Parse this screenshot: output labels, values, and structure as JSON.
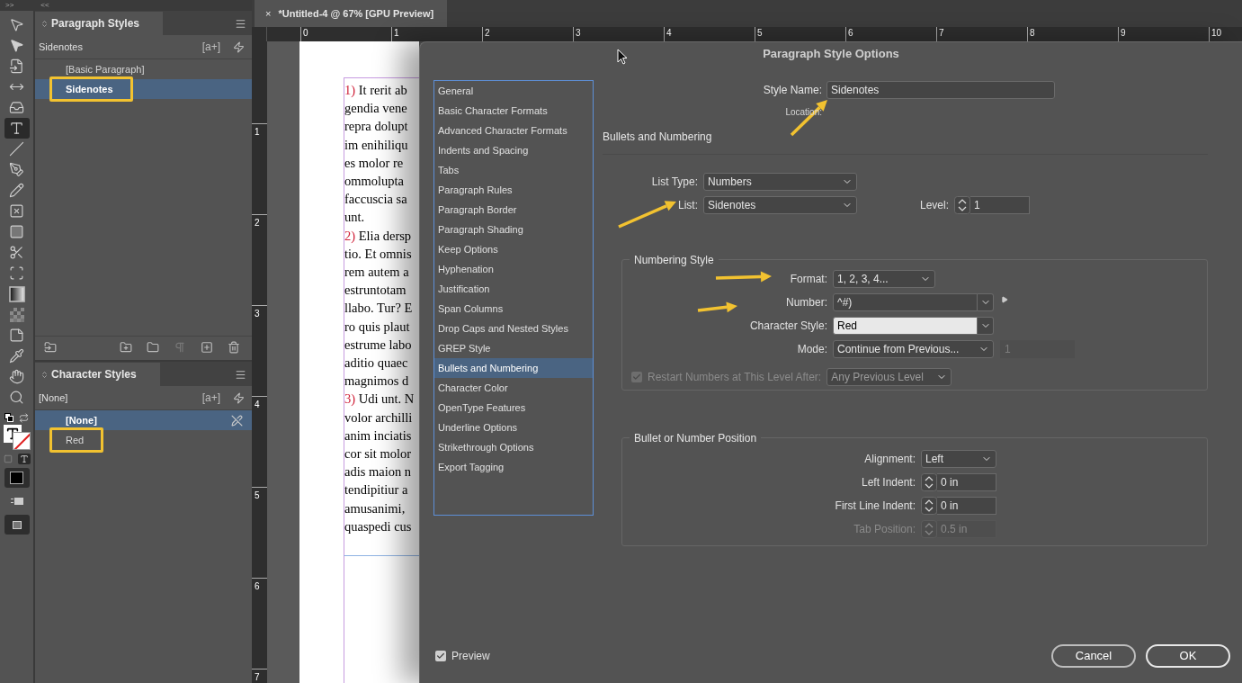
{
  "toolbar": {
    "collapse": ">>",
    "tools": [
      {
        "kind": "select",
        "selected": false
      },
      {
        "kind": "direct-select",
        "selected": false
      },
      {
        "kind": "page",
        "selected": false
      },
      {
        "kind": "gap",
        "selected": false
      },
      {
        "kind": "collector",
        "selected": false
      },
      {
        "kind": "type",
        "selected": true
      },
      {
        "kind": "line",
        "selected": false
      },
      {
        "kind": "pen",
        "selected": false
      },
      {
        "kind": "pencil",
        "selected": false
      },
      {
        "kind": "frame",
        "selected": false
      },
      {
        "kind": "rectangle",
        "selected": false
      },
      {
        "kind": "scissors",
        "selected": false
      },
      {
        "kind": "transform",
        "selected": false
      },
      {
        "kind": "gradient",
        "selected": false
      },
      {
        "kind": "feather",
        "selected": false
      },
      {
        "kind": "note",
        "selected": false
      },
      {
        "kind": "eyedropper",
        "selected": false
      },
      {
        "kind": "hand",
        "selected": false
      },
      {
        "kind": "zoom",
        "selected": false
      }
    ]
  },
  "panels_collapse": "<<",
  "paragraph_styles": {
    "title": "Paragraph Styles",
    "current": "Sidenotes",
    "new_style": "[a+]",
    "items": [
      {
        "label": "[Basic Paragraph]",
        "selected": false,
        "highlighted": false
      },
      {
        "label": "Sidenotes",
        "selected": true,
        "highlighted": true
      }
    ]
  },
  "character_styles": {
    "title": "Character Styles",
    "current": "[None]",
    "new_style": "[a+]",
    "items": [
      {
        "label": "[None]",
        "selected": true,
        "highlighted": false
      },
      {
        "label": "Red",
        "selected": false,
        "highlighted": true
      }
    ]
  },
  "document_tab": {
    "close": "×",
    "title": "*Untitled-4 @ 67% [GPU Preview]"
  },
  "ruler": {
    "horizontal": [
      "0",
      "1",
      "2",
      "3",
      "4",
      "5",
      "6",
      "7",
      "8",
      "9",
      "10"
    ],
    "vertical": [
      "1",
      "2",
      "3",
      "4",
      "5",
      "6",
      "7"
    ]
  },
  "document": {
    "paragraphs": [
      {
        "number": "1)",
        "lines": [
          "It rerit ab",
          "gendia vene",
          "repra dolupt",
          "im enihiliqu",
          "es molor re",
          "ommolupta",
          "faccuscia sa",
          "unt."
        ]
      },
      {
        "number": "2)",
        "lines": [
          "Elia dersp",
          "tio. Et omnis",
          "rem autem a",
          "estruntotam",
          "llabo. Tur? E",
          "ro quis plaut",
          "estrume labo",
          "aditio quaec",
          "magnimos d"
        ]
      },
      {
        "number": "3)",
        "lines": [
          "Udi unt. N",
          "volor archilli",
          "anim inciatis",
          "cor sit molor",
          "adis maion n",
          "tendipitiur a",
          "amusanimi,",
          "quaspedi cus"
        ]
      }
    ]
  },
  "dialog": {
    "title": "Paragraph Style Options",
    "categories": [
      {
        "label": "General",
        "selected": false
      },
      {
        "label": "Basic Character Formats",
        "selected": false
      },
      {
        "label": "Advanced Character Formats",
        "selected": false
      },
      {
        "label": "Indents and Spacing",
        "selected": false
      },
      {
        "label": "Tabs",
        "selected": false
      },
      {
        "label": "Paragraph Rules",
        "selected": false
      },
      {
        "label": "Paragraph Border",
        "selected": false
      },
      {
        "label": "Paragraph Shading",
        "selected": false
      },
      {
        "label": "Keep Options",
        "selected": false
      },
      {
        "label": "Hyphenation",
        "selected": false
      },
      {
        "label": "Justification",
        "selected": false
      },
      {
        "label": "Span Columns",
        "selected": false
      },
      {
        "label": "Drop Caps and Nested Styles",
        "selected": false
      },
      {
        "label": "GREP Style",
        "selected": false
      },
      {
        "label": "Bullets and Numbering",
        "selected": true
      },
      {
        "label": "Character Color",
        "selected": false
      },
      {
        "label": "OpenType Features",
        "selected": false
      },
      {
        "label": "Underline Options",
        "selected": false
      },
      {
        "label": "Strikethrough Options",
        "selected": false
      },
      {
        "label": "Export Tagging",
        "selected": false
      }
    ],
    "style_name": {
      "label": "Style Name:",
      "value": "Sidenotes"
    },
    "location_label": "Location:",
    "section_title": "Bullets and Numbering",
    "list_type": {
      "label": "List Type:",
      "value": "Numbers"
    },
    "list": {
      "label": "List:",
      "value": "Sidenotes"
    },
    "level": {
      "label": "Level:",
      "value": "1"
    },
    "numbering_style": {
      "title": "Numbering Style",
      "format": {
        "label": "Format:",
        "value": "1, 2, 3, 4..."
      },
      "number": {
        "label": "Number:",
        "value": "^#)",
        "focused": false
      },
      "character_style": {
        "label": "Character Style:",
        "value": "Red",
        "focused": true
      },
      "mode": {
        "label": "Mode:",
        "value": "Continue from Previous...",
        "start": "1",
        "start_disabled": true
      },
      "restart": {
        "label": "Restart Numbers at This Level After:",
        "checked": true,
        "disabled": true,
        "value": "Any Previous Level"
      }
    },
    "position": {
      "title": "Bullet or Number Position",
      "alignment": {
        "label": "Alignment:",
        "value": "Left"
      },
      "indents": [
        {
          "label": "Left Indent:",
          "value": "0 in",
          "disabled": false
        },
        {
          "label": "First Line Indent:",
          "value": "0 in",
          "disabled": false
        },
        {
          "label": "Tab Position:",
          "value": "0.5 in",
          "disabled": true
        }
      ]
    },
    "preview": {
      "label": "Preview",
      "checked": true
    },
    "buttons": [
      {
        "label": "Cancel",
        "kind": "cancel"
      },
      {
        "label": "OK",
        "kind": "default"
      }
    ]
  }
}
